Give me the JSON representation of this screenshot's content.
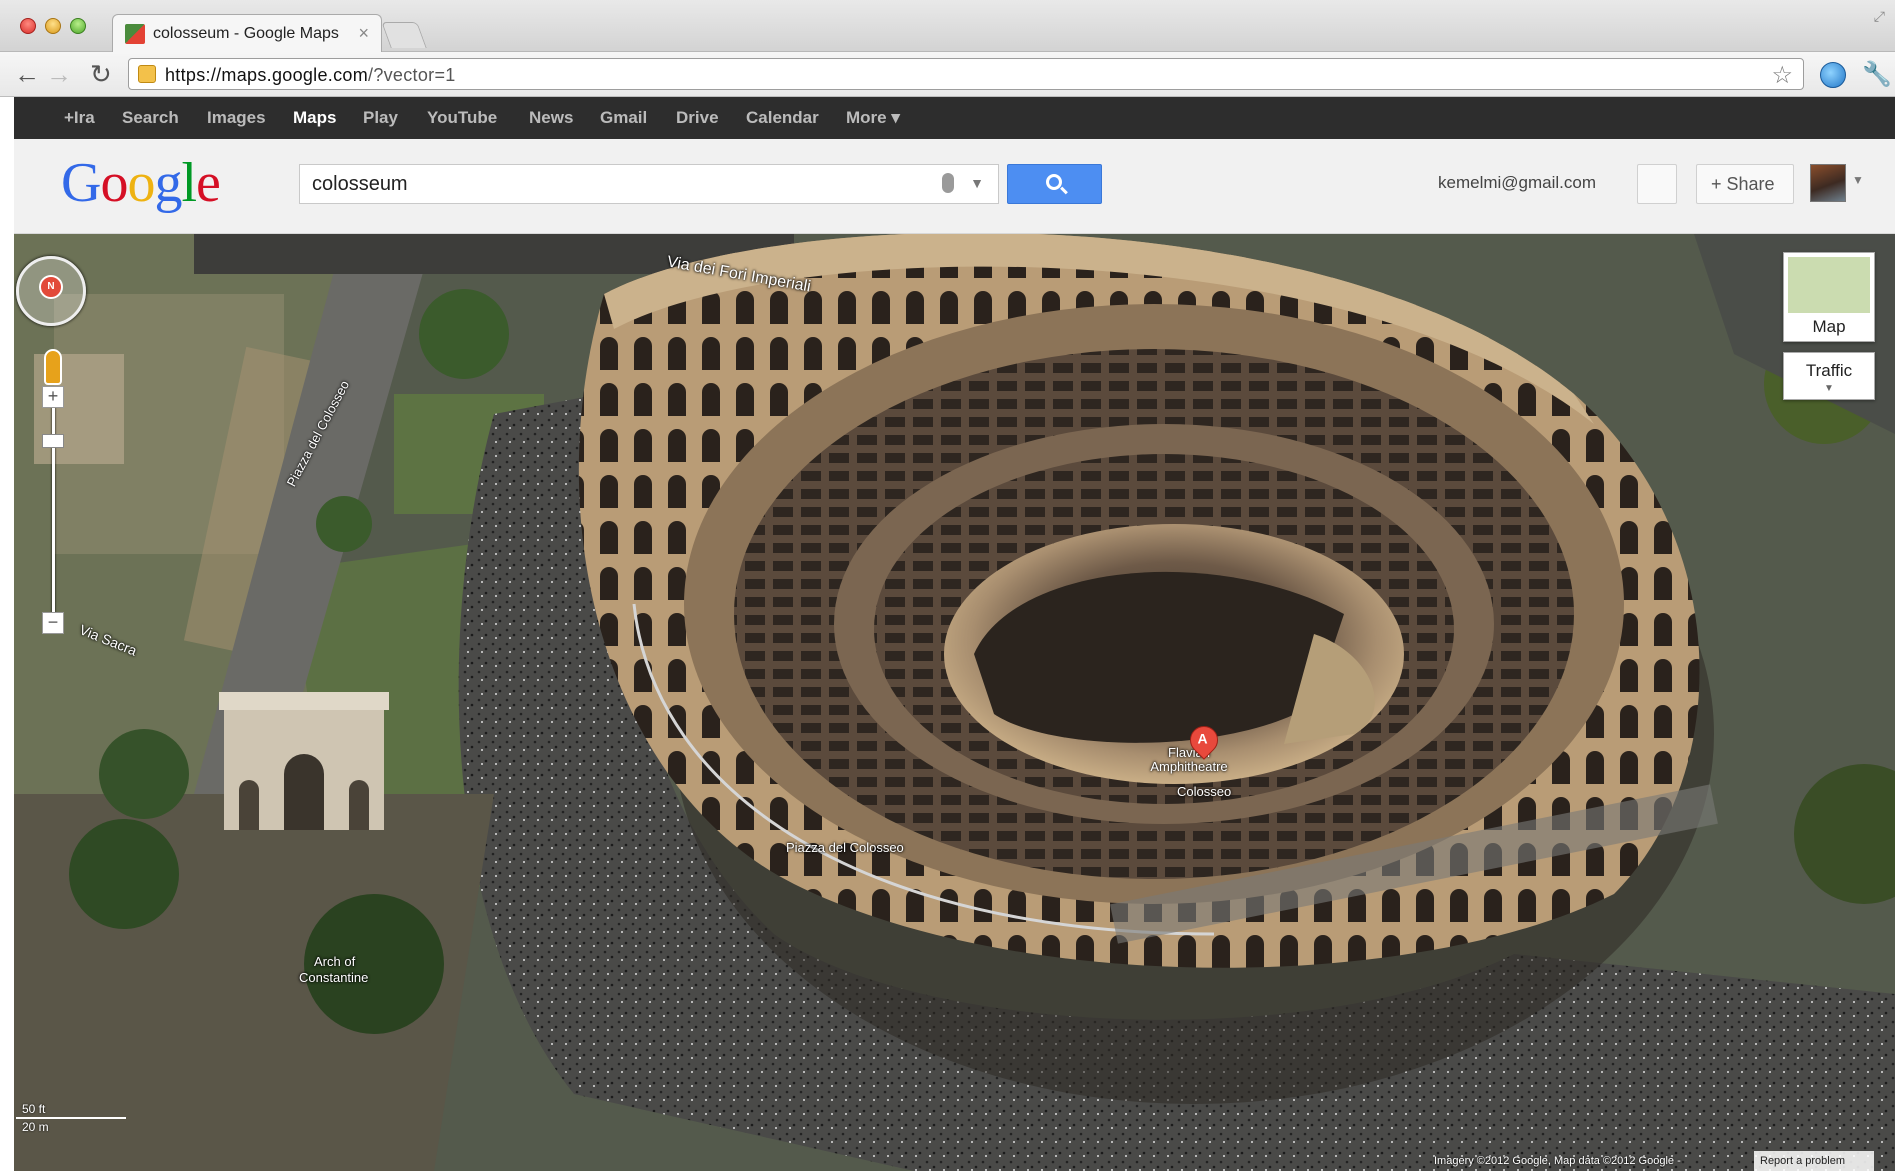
{
  "browser": {
    "tab_title": "colosseum - Google Maps",
    "tab_close": "×",
    "url_host": "https://maps.google.com",
    "url_path": "/?vector=1"
  },
  "gbar": {
    "items": [
      "+Ira",
      "Search",
      "Images",
      "Maps",
      "Play",
      "YouTube",
      "News",
      "Gmail",
      "Drive",
      "Calendar",
      "More ▾"
    ]
  },
  "header": {
    "logo": [
      "G",
      "o",
      "o",
      "g",
      "l",
      "e"
    ],
    "search_value": "colosseum",
    "email": "kemelmi@gmail.com",
    "share_label": "+  Share"
  },
  "map": {
    "labels": {
      "via_fori": "Via dei Fori Imperiali",
      "piazza_vertical": "Piazza del Colosseo",
      "via_sacra": "Via Sacra",
      "flavian": "Flavian Amphitheatre",
      "colosseo": "Colosseo",
      "piazza": "Piazza del Colosseo",
      "arch_1": "Arch of",
      "arch_2": "Constantine"
    },
    "compass_label": "N",
    "marker_label": "A",
    "zoom_in": "+",
    "zoom_out": "−",
    "map_type_label": "Map",
    "traffic_label": "Traffic",
    "scale_ft": "50 ft",
    "scale_m": "20 m",
    "attribution": "Imagery ©2012 Google, Map data ©2012 Google -",
    "report": "Report a problem"
  }
}
